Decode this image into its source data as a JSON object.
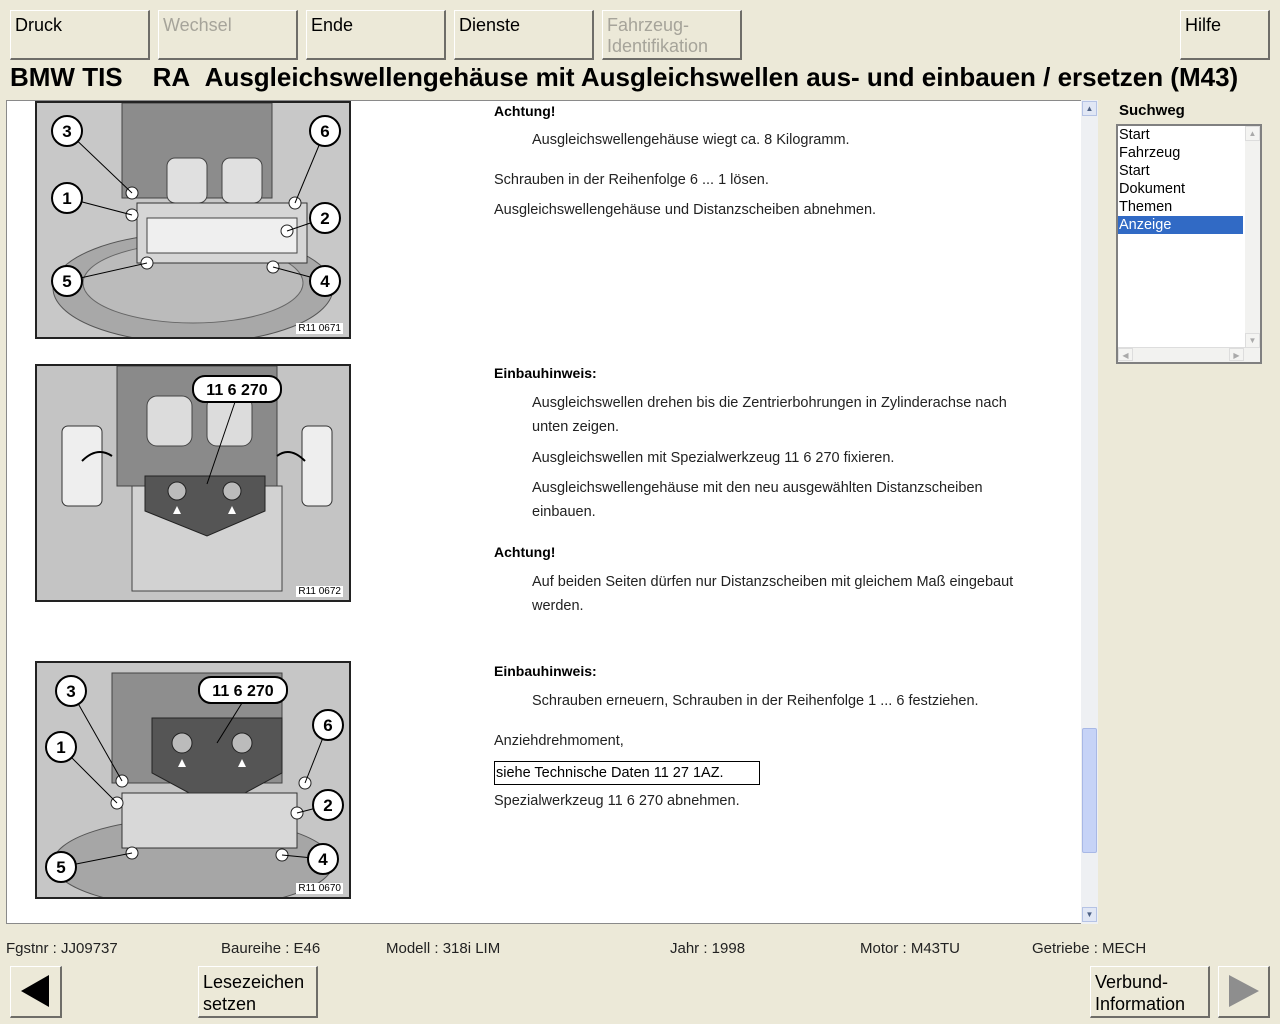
{
  "toolbar": {
    "druck": "Druck",
    "wechsel": "Wechsel",
    "ende": "Ende",
    "dienste": "Dienste",
    "fahrzeug_line1": "Fahrzeug-",
    "fahrzeug_line2": "Identifikation",
    "hilfe": "Hilfe"
  },
  "header": {
    "app": "BMW TIS",
    "prefix": "RA",
    "title": "Ausgleichswellengehäuse mit Ausgleichswellen aus- und einbauen / ersetzen (M43)"
  },
  "figures": [
    {
      "code": "R11 0671",
      "numbers": [
        "3",
        "6",
        "1",
        "2",
        "5",
        "4"
      ]
    },
    {
      "code": "R11 0672",
      "tool": "11 6 270"
    },
    {
      "code": "R11 0670",
      "tool": "11 6 270",
      "numbers": [
        "3",
        "1",
        "6",
        "2",
        "5",
        "4"
      ]
    }
  ],
  "sections": {
    "s1_heading": "Achtung!",
    "s1_note": "Ausgleichswellengehäuse wiegt ca. 8 Kilogramm.",
    "s1_step1": "Schrauben in der Reihenfolge 6 ... 1 lösen.",
    "s1_step2": "Ausgleichswellengehäuse und Distanzscheiben abnehmen.",
    "s2_heading": "Einbauhinweis:",
    "s2_p1_line1": "Ausgleichswellen drehen bis die Zentrierbohrungen in Zylinderachse nach",
    "s2_p1_line2": "unten zeigen.",
    "s2_p2": "Ausgleichswellen mit Spezialwerkzeug 11 6 270 fixieren.",
    "s2_p3_line1": "Ausgleichswellengehäuse mit den neu ausgewählten Distanzscheiben",
    "s2_p3_line2": "einbauen.",
    "s3_heading": "Achtung!",
    "s3_p1_line1": "Auf beiden Seiten dürfen nur Distanzscheiben mit gleichem Maß eingebaut",
    "s3_p1_line2": "werden.",
    "s4_heading": "Einbauhinweis:",
    "s4_p1": "Schrauben erneuern, Schrauben in der Reihenfolge 1 ... 6 festziehen.",
    "s4_torque": "Anziehdrehmoment,",
    "s4_link": "siehe Technische Daten 11 27 1AZ.",
    "s4_last": "Spezialwerkzeug 11 6 270 abnehmen."
  },
  "suchweg": {
    "title": "Suchweg",
    "items": [
      "Start",
      "Fahrzeug",
      "Start",
      "Dokument",
      "Themen",
      "Anzeige"
    ]
  },
  "status": {
    "fgstnr": "Fgstnr : JJ09737",
    "baureihe": "Baureihe : E46",
    "modell": "Modell : 318i LIM",
    "jahr": "Jahr : 1998",
    "motor": "Motor : M43TU",
    "getriebe": "Getriebe : MECH"
  },
  "bottom": {
    "lesezeichen_line1": "Lesezeichen",
    "lesezeichen_line2": "setzen",
    "verbund_line1": "Verbund-",
    "verbund_line2": "Information"
  }
}
